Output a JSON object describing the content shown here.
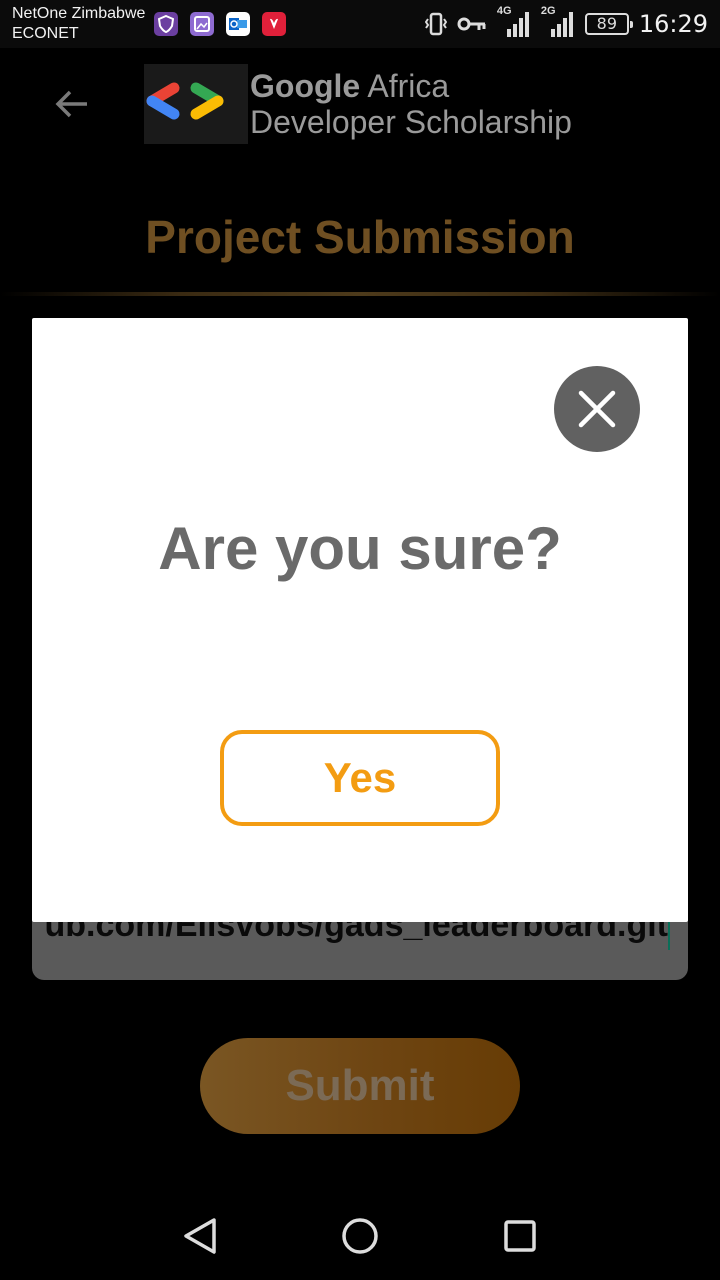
{
  "status_bar": {
    "carrier_line1": "NetOne Zimbabwe",
    "carrier_line2": "ECONET",
    "net1": "4G",
    "net2": "2G",
    "battery": "89",
    "time": "16:29",
    "notif_icons": [
      "shield-app-icon",
      "gallery-icon",
      "outlook-icon",
      "huawei-icon"
    ]
  },
  "header": {
    "brand_google": "Google",
    "brand_africa": " Africa",
    "brand_line2": "Developer Scholarship",
    "logo_colors": [
      "#ea4335",
      "#4285f4",
      "#34a853",
      "#fbbc04"
    ]
  },
  "page": {
    "title": "Project Submission",
    "link_value": "ub.com/Elisvobs/gads_leaderboard.git",
    "submit_label": "Submit"
  },
  "dialog": {
    "message": "Are you sure?",
    "yes_label": "Yes",
    "accent": "#f39c12"
  }
}
